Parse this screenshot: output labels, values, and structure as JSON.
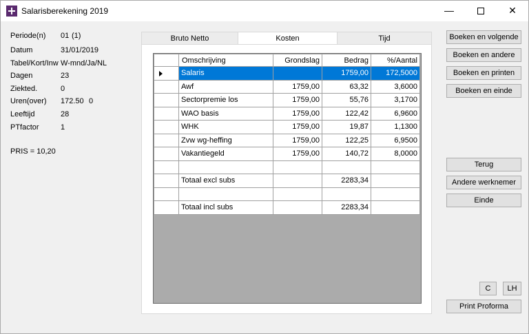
{
  "window": {
    "title": "Salarisberekening 2019",
    "minimize": "—",
    "close": "✕"
  },
  "info": [
    {
      "label": "Periode(n)",
      "v1": "01",
      "v2": "(1)"
    },
    {
      "label": "Datum",
      "v1": "31/01/2019",
      "v2": ""
    },
    {
      "label": "Tabel/Kort/Inw",
      "v1": "W-mnd/Ja/NL",
      "v2": ""
    },
    {
      "label": "Dagen",
      "v1": "23",
      "v2": ""
    },
    {
      "label": "Ziekted.",
      "v1": "0",
      "v2": ""
    },
    {
      "label": "Uren(over)",
      "v1": "172.50",
      "v2": "0"
    },
    {
      "label": "Leeftijd",
      "v1": "28",
      "v2": ""
    },
    {
      "label": "PTfactor",
      "v1": "1",
      "v2": ""
    }
  ],
  "pris": "PRIS = 10,20",
  "tabs": [
    "Bruto Netto",
    "Kosten",
    "Tijd"
  ],
  "grid": {
    "headers": [
      "Omschrijving",
      "Grondslag",
      "Bedrag",
      "%/Aantal"
    ],
    "rows": [
      [
        "Salaris",
        "",
        "1759,00",
        "172,5000"
      ],
      [
        "Awf",
        "1759,00",
        "63,32",
        "3,6000"
      ],
      [
        "Sectorpremie los",
        "1759,00",
        "55,76",
        "3,1700"
      ],
      [
        "WAO basis",
        "1759,00",
        "122,42",
        "6,9600"
      ],
      [
        "WHK",
        "1759,00",
        "19,87",
        "1,1300"
      ],
      [
        "Zvw wg-heffing",
        "1759,00",
        "122,25",
        "6,9500"
      ],
      [
        "Vakantiegeld",
        "1759,00",
        "140,72",
        "8,0000"
      ],
      [
        "",
        "",
        "",
        ""
      ],
      [
        "Totaal excl subs",
        "",
        "2283,34",
        ""
      ],
      [
        "",
        "",
        "",
        ""
      ],
      [
        "Totaal incl subs",
        "",
        "2283,34",
        ""
      ]
    ]
  },
  "buttons": {
    "boeken_volgende": "Boeken en volgende",
    "boeken_andere": "Boeken en andere",
    "boeken_printen": "Boeken en printen",
    "boeken_einde": "Boeken en einde",
    "terug": "Terug",
    "andere_werknemer": "Andere werknemer",
    "einde": "Einde",
    "c": "C",
    "lh": "LH",
    "print_proforma": "Print Proforma"
  }
}
